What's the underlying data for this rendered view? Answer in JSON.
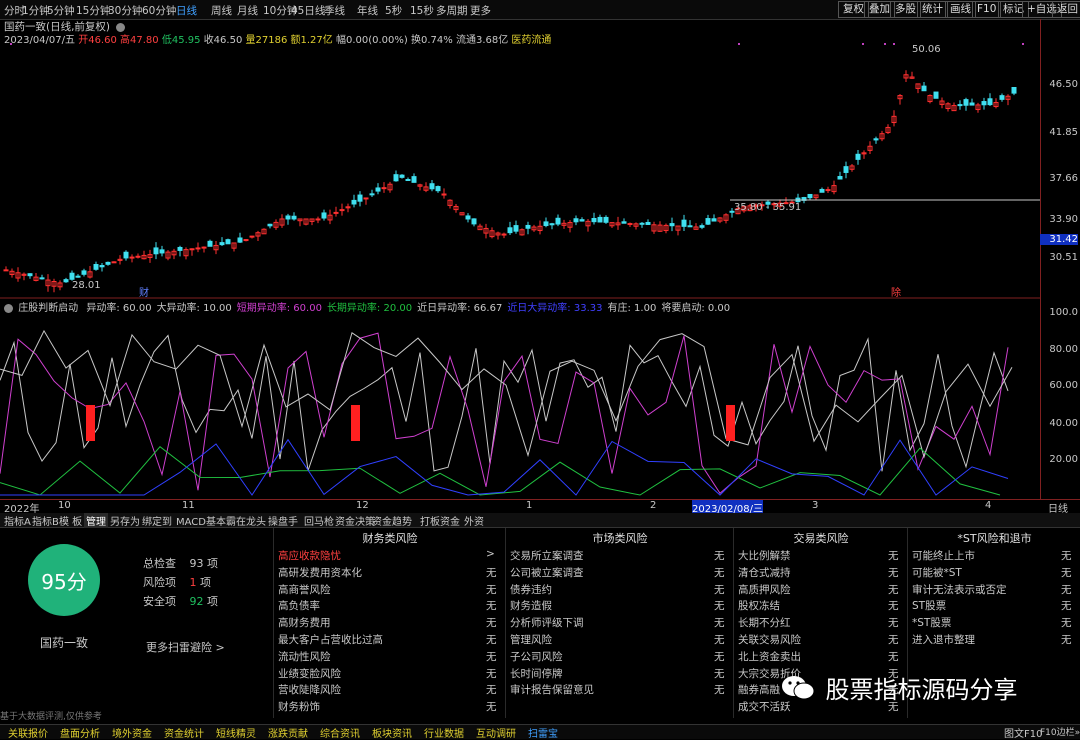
{
  "toolbar": {
    "periods": [
      "分时",
      "1分钟",
      "5分钟",
      "15分钟",
      "30分钟",
      "60分钟",
      "日线",
      "周线",
      "月线",
      "10分钟",
      "45日线",
      "季线",
      "年线",
      "5秒",
      "15秒",
      "多周期",
      "更多"
    ],
    "active_period": "日线",
    "right_buttons": [
      "复权",
      "叠加",
      "多股",
      "统计",
      "画线",
      "F10",
      "标记",
      "+自选",
      "返回"
    ]
  },
  "chart": {
    "title": "国药一致(日线,前复权)",
    "date": "2023/04/07/五",
    "open": "开46.60",
    "high": "高47.80",
    "low": "低45.95",
    "close": "收46.50",
    "volume": "量27186",
    "amount": "额1.27亿",
    "change": "幅0.00(0.00%)",
    "turnover": "换0.74%",
    "float": "流通3.68亿",
    "sector": "医药流通",
    "annot_high": "50.06",
    "annot_low": "28.01",
    "annot_box": "35.80 - 35.91",
    "marker_fin": "财",
    "marker_div": "除",
    "current_price": "31.42",
    "price_labels": [
      "46.50",
      "41.85",
      "37.66",
      "33.90",
      "30.51"
    ]
  },
  "indicator": {
    "title": "庄股判断启动",
    "params": [
      {
        "label": "异动率: 60.00",
        "color": "#c8c8c8"
      },
      {
        "label": "大异动率: 10.00",
        "color": "#c8c8c8"
      },
      {
        "label": "短期异动率: 60.00",
        "color": "#d040d0"
      },
      {
        "label": "长期异动率: 20.00",
        "color": "#20c040"
      },
      {
        "label": "近日异动率: 66.67",
        "color": "#c8c8c8"
      },
      {
        "label": "近日大异动率: 33.33",
        "color": "#4040ff"
      },
      {
        "label": "有庄: 1.00",
        "color": "#c8c8c8"
      },
      {
        "label": "将要启动: 0.00",
        "color": "#c8c8c8"
      }
    ],
    "axis_labels": [
      "100.0",
      "80.00",
      "60.00",
      "40.00",
      "20.00"
    ]
  },
  "timebar": {
    "labels": [
      "2022年",
      "10",
      "11",
      "12",
      "1",
      "2",
      "2023/02/08/三",
      "3",
      "4"
    ],
    "period": "日线"
  },
  "tabs": [
    "指标A",
    "指标B",
    "模 板",
    "管理",
    "另存为",
    "绑定到",
    "MACD基本",
    "霸在龙头",
    "操盘手",
    "回马枪",
    "资金决策",
    "资金趋势",
    "打板资金",
    "外资"
  ],
  "selected_tab": "管理",
  "scan": {
    "score": "95分",
    "stock_name": "国药一致",
    "total_label": "总检查",
    "total_value": "93",
    "risk_label": "风险项",
    "risk_value": "1",
    "safe_label": "安全项",
    "safe_value": "92",
    "unit": "项",
    "more_link": "更多扫雷避险 >",
    "columns": [
      {
        "title": "财务类风险",
        "items": [
          "高应收款隐忧",
          "高研发费用资本化",
          "高商誉风险",
          "高负债率",
          "高财务费用",
          "最大客户占营收比过高",
          "流动性风险",
          "业绩变脸风险",
          "营收陡降风险",
          "财务粉饰"
        ]
      },
      {
        "title": "市场类风险",
        "items": [
          "交易所立案调查",
          "公司被立案调查",
          "债券违约",
          "财务造假",
          "分析师评级下调",
          "管理风险",
          "子公司风险",
          "长时间停牌",
          "审计报告保留意见"
        ]
      },
      {
        "title": "交易类风险",
        "items": [
          "大比例解禁",
          "清仓式减持",
          "高质押风险",
          "股权冻结",
          "长期不分红",
          "关联交易风险",
          "北上资金卖出",
          "大宗交易折价",
          "融券高融",
          "成交不活跃"
        ]
      },
      {
        "title": "*ST风险和退市",
        "items": [
          "可能终止上市",
          "可能被*ST",
          "审计无法表示或否定",
          "ST股票",
          "*ST股票",
          "进入退市整理"
        ]
      }
    ],
    "none_label": "无",
    "note": "基于大数据评测,仅供参考"
  },
  "watermark": "股票指标源码分享",
  "status": {
    "items": [
      "关联报价",
      "盘面分析",
      "境外资金",
      "资金统计",
      "短线精灵",
      "涨跌贡献",
      "综合资讯",
      "板块资讯",
      "行业数据",
      "互动调研",
      "扫雷宝"
    ],
    "right": "图文F10",
    "right2": "F10边栏»"
  }
}
